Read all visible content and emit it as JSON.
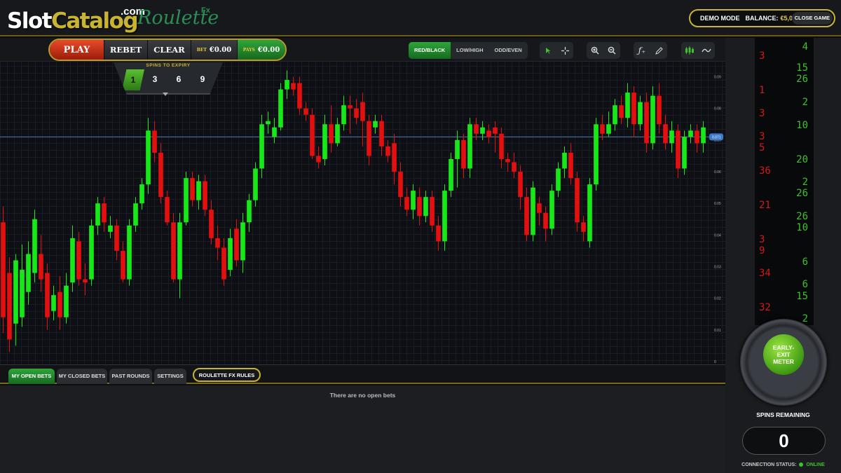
{
  "header": {
    "logo_left": "Slot",
    "logo_right": "Catalog",
    "logo_com": ".com",
    "game_title": "Roulette",
    "game_suffix": "Fx",
    "demo_label": "DEMO MODE",
    "balance_label": "BALANCE:",
    "balance_value": "€5,000.00",
    "close_label": "CLOSE GAME"
  },
  "controls": {
    "play": "PLAY",
    "rebet": "REBET",
    "clear": "CLEAR",
    "bet_label": "BET",
    "bet_value": "€0.00",
    "pays_label": "PAYS",
    "pays_value": "€0.00"
  },
  "spins_to_expiry": {
    "title": "SPINS TO EXPIRY",
    "options": [
      "1",
      "3",
      "6",
      "9"
    ],
    "selected": "1"
  },
  "bet_types": [
    "RED/BLACK",
    "LOW/HIGH",
    "ODD/EVEN"
  ],
  "active_bet_type": "RED/BLACK",
  "tools": {
    "cursor": "cursor-icon",
    "crosshair": "crosshair-icon",
    "zoom_in": "zoom-in-icon",
    "zoom_out": "zoom-out-icon",
    "function": "function-icon",
    "pencil": "pencil-icon",
    "candles": "candlestick-icon",
    "line": "line-chart-icon"
  },
  "chart_data": {
    "type": "candlestick",
    "y_ticks": [
      "0.09",
      "0.08",
      "0.07",
      "0.06",
      "0.05",
      "0.04",
      "0.03",
      "0.02",
      "0.01",
      "0"
    ],
    "ylim": [
      0,
      0.093
    ],
    "current_price": "0.071",
    "colors": {
      "up": "#17e817",
      "down": "#e40f0f"
    },
    "candles": [
      {
        "o": 0.044,
        "c": 0.014,
        "h": 0.049,
        "l": 0.009
      },
      {
        "o": 0.028,
        "c": 0.007,
        "h": 0.033,
        "l": 0.003
      },
      {
        "o": 0.012,
        "c": 0.032,
        "h": 0.034,
        "l": 0.005
      },
      {
        "o": 0.014,
        "c": 0.029,
        "h": 0.037,
        "l": 0.011
      },
      {
        "o": 0.022,
        "c": 0.034,
        "h": 0.038,
        "l": 0.018
      },
      {
        "o": 0.028,
        "c": 0.045,
        "h": 0.048,
        "l": 0.025
      },
      {
        "o": 0.034,
        "c": 0.026,
        "h": 0.04,
        "l": 0.022
      },
      {
        "o": 0.028,
        "c": 0.014,
        "h": 0.031,
        "l": 0.01
      },
      {
        "o": 0.016,
        "c": 0.021,
        "h": 0.024,
        "l": 0.013
      },
      {
        "o": 0.022,
        "c": 0.014,
        "h": 0.027,
        "l": 0.01
      },
      {
        "o": 0.014,
        "c": 0.024,
        "h": 0.028,
        "l": 0.012
      },
      {
        "o": 0.025,
        "c": 0.039,
        "h": 0.043,
        "l": 0.022
      },
      {
        "o": 0.038,
        "c": 0.026,
        "h": 0.041,
        "l": 0.024
      },
      {
        "o": 0.026,
        "c": 0.025,
        "h": 0.031,
        "l": 0.021
      },
      {
        "o": 0.026,
        "c": 0.043,
        "h": 0.045,
        "l": 0.024
      },
      {
        "o": 0.043,
        "c": 0.05,
        "h": 0.052,
        "l": 0.04
      },
      {
        "o": 0.05,
        "c": 0.044,
        "h": 0.052,
        "l": 0.041
      },
      {
        "o": 0.041,
        "c": 0.043,
        "h": 0.046,
        "l": 0.039
      },
      {
        "o": 0.043,
        "c": 0.035,
        "h": 0.045,
        "l": 0.032
      },
      {
        "o": 0.035,
        "c": 0.026,
        "h": 0.038,
        "l": 0.025
      },
      {
        "o": 0.026,
        "c": 0.043,
        "h": 0.045,
        "l": 0.024
      },
      {
        "o": 0.043,
        "c": 0.05,
        "h": 0.052,
        "l": 0.041
      },
      {
        "o": 0.05,
        "c": 0.056,
        "h": 0.058,
        "l": 0.048
      },
      {
        "o": 0.056,
        "c": 0.073,
        "h": 0.077,
        "l": 0.053
      },
      {
        "o": 0.073,
        "c": 0.066,
        "h": 0.076,
        "l": 0.063
      },
      {
        "o": 0.066,
        "c": 0.052,
        "h": 0.069,
        "l": 0.05
      },
      {
        "o": 0.052,
        "c": 0.044,
        "h": 0.054,
        "l": 0.043
      },
      {
        "o": 0.044,
        "c": 0.026,
        "h": 0.047,
        "l": 0.025
      },
      {
        "o": 0.026,
        "c": 0.044,
        "h": 0.047,
        "l": 0.02
      },
      {
        "o": 0.044,
        "c": 0.058,
        "h": 0.06,
        "l": 0.043
      },
      {
        "o": 0.058,
        "c": 0.051,
        "h": 0.06,
        "l": 0.049
      },
      {
        "o": 0.051,
        "c": 0.057,
        "h": 0.059,
        "l": 0.048
      },
      {
        "o": 0.057,
        "c": 0.048,
        "h": 0.059,
        "l": 0.046
      },
      {
        "o": 0.048,
        "c": 0.039,
        "h": 0.051,
        "l": 0.037
      },
      {
        "o": 0.039,
        "c": 0.036,
        "h": 0.043,
        "l": 0.032
      },
      {
        "o": 0.036,
        "c": 0.026,
        "h": 0.039,
        "l": 0.024
      },
      {
        "o": 0.029,
        "c": 0.039,
        "h": 0.042,
        "l": 0.027
      },
      {
        "o": 0.042,
        "c": 0.032,
        "h": 0.045,
        "l": 0.03
      },
      {
        "o": 0.032,
        "c": 0.044,
        "h": 0.047,
        "l": 0.028
      },
      {
        "o": 0.044,
        "c": 0.051,
        "h": 0.053,
        "l": 0.041
      },
      {
        "o": 0.051,
        "c": 0.061,
        "h": 0.063,
        "l": 0.049
      },
      {
        "o": 0.061,
        "c": 0.075,
        "h": 0.078,
        "l": 0.058
      },
      {
        "o": 0.075,
        "c": 0.076,
        "h": 0.079,
        "l": 0.072
      },
      {
        "o": 0.071,
        "c": 0.074,
        "h": 0.077,
        "l": 0.069
      },
      {
        "o": 0.074,
        "c": 0.086,
        "h": 0.088,
        "l": 0.073
      },
      {
        "o": 0.086,
        "c": 0.089,
        "h": 0.092,
        "l": 0.083
      },
      {
        "o": 0.088,
        "c": 0.086,
        "h": 0.09,
        "l": 0.084
      },
      {
        "o": 0.088,
        "c": 0.08,
        "h": 0.09,
        "l": 0.078
      },
      {
        "o": 0.08,
        "c": 0.078,
        "h": 0.082,
        "l": 0.076
      },
      {
        "o": 0.078,
        "c": 0.065,
        "h": 0.08,
        "l": 0.064
      },
      {
        "o": 0.065,
        "c": 0.063,
        "h": 0.068,
        "l": 0.061
      },
      {
        "o": 0.064,
        "c": 0.075,
        "h": 0.078,
        "l": 0.062
      },
      {
        "o": 0.075,
        "c": 0.069,
        "h": 0.081,
        "l": 0.066
      },
      {
        "o": 0.069,
        "c": 0.075,
        "h": 0.077,
        "l": 0.068
      },
      {
        "o": 0.075,
        "c": 0.081,
        "h": 0.084,
        "l": 0.073
      },
      {
        "o": 0.081,
        "c": 0.08,
        "h": 0.084,
        "l": 0.072
      },
      {
        "o": 0.08,
        "c": 0.077,
        "h": 0.083,
        "l": 0.075
      },
      {
        "o": 0.082,
        "c": 0.076,
        "h": 0.085,
        "l": 0.068
      },
      {
        "o": 0.076,
        "c": 0.065,
        "h": 0.078,
        "l": 0.062
      },
      {
        "o": 0.074,
        "c": 0.076,
        "h": 0.078,
        "l": 0.072
      },
      {
        "o": 0.076,
        "c": 0.068,
        "h": 0.078,
        "l": 0.065
      },
      {
        "o": 0.068,
        "c": 0.065,
        "h": 0.07,
        "l": 0.063
      },
      {
        "o": 0.069,
        "c": 0.06,
        "h": 0.072,
        "l": 0.056
      },
      {
        "o": 0.06,
        "c": 0.052,
        "h": 0.063,
        "l": 0.049
      },
      {
        "o": 0.052,
        "c": 0.048,
        "h": 0.055,
        "l": 0.046
      },
      {
        "o": 0.048,
        "c": 0.054,
        "h": 0.056,
        "l": 0.045
      },
      {
        "o": 0.052,
        "c": 0.046,
        "h": 0.055,
        "l": 0.043
      },
      {
        "o": 0.046,
        "c": 0.052,
        "h": 0.054,
        "l": 0.044
      },
      {
        "o": 0.052,
        "c": 0.043,
        "h": 0.054,
        "l": 0.041
      },
      {
        "o": 0.043,
        "c": 0.038,
        "h": 0.046,
        "l": 0.035
      },
      {
        "o": 0.038,
        "c": 0.054,
        "h": 0.056,
        "l": 0.035
      },
      {
        "o": 0.054,
        "c": 0.064,
        "h": 0.066,
        "l": 0.052
      },
      {
        "o": 0.064,
        "c": 0.07,
        "h": 0.073,
        "l": 0.055
      },
      {
        "o": 0.07,
        "c": 0.061,
        "h": 0.072,
        "l": 0.058
      },
      {
        "o": 0.061,
        "c": 0.075,
        "h": 0.077,
        "l": 0.058
      },
      {
        "o": 0.075,
        "c": 0.072,
        "h": 0.077,
        "l": 0.07
      },
      {
        "o": 0.072,
        "c": 0.074,
        "h": 0.076,
        "l": 0.07
      },
      {
        "o": 0.073,
        "c": 0.071,
        "h": 0.075,
        "l": 0.069
      },
      {
        "o": 0.074,
        "c": 0.072,
        "h": 0.076,
        "l": 0.066
      },
      {
        "o": 0.072,
        "c": 0.064,
        "h": 0.074,
        "l": 0.061
      },
      {
        "o": 0.064,
        "c": 0.063,
        "h": 0.066,
        "l": 0.06
      },
      {
        "o": 0.063,
        "c": 0.06,
        "h": 0.066,
        "l": 0.058
      },
      {
        "o": 0.06,
        "c": 0.052,
        "h": 0.062,
        "l": 0.048
      },
      {
        "o": 0.052,
        "c": 0.04,
        "h": 0.055,
        "l": 0.038
      },
      {
        "o": 0.04,
        "c": 0.055,
        "h": 0.057,
        "l": 0.038
      },
      {
        "o": 0.05,
        "c": 0.047,
        "h": 0.052,
        "l": 0.043
      },
      {
        "o": 0.047,
        "c": 0.042,
        "h": 0.049,
        "l": 0.038
      },
      {
        "o": 0.042,
        "c": 0.054,
        "h": 0.056,
        "l": 0.04
      },
      {
        "o": 0.054,
        "c": 0.061,
        "h": 0.063,
        "l": 0.052
      },
      {
        "o": 0.061,
        "c": 0.066,
        "h": 0.068,
        "l": 0.058
      },
      {
        "o": 0.066,
        "c": 0.058,
        "h": 0.069,
        "l": 0.056
      },
      {
        "o": 0.058,
        "c": 0.044,
        "h": 0.06,
        "l": 0.041
      },
      {
        "o": 0.044,
        "c": 0.041,
        "h": 0.046,
        "l": 0.038
      },
      {
        "o": 0.038,
        "c": 0.056,
        "h": 0.058,
        "l": 0.036
      },
      {
        "o": 0.056,
        "c": 0.075,
        "h": 0.077,
        "l": 0.054
      },
      {
        "o": 0.075,
        "c": 0.072,
        "h": 0.078,
        "l": 0.07
      },
      {
        "o": 0.072,
        "c": 0.075,
        "h": 0.079,
        "l": 0.071
      },
      {
        "o": 0.075,
        "c": 0.081,
        "h": 0.083,
        "l": 0.073
      },
      {
        "o": 0.081,
        "c": 0.077,
        "h": 0.084,
        "l": 0.075
      },
      {
        "o": 0.077,
        "c": 0.085,
        "h": 0.088,
        "l": 0.074
      },
      {
        "o": 0.085,
        "c": 0.075,
        "h": 0.087,
        "l": 0.071
      },
      {
        "o": 0.075,
        "c": 0.082,
        "h": 0.084,
        "l": 0.073
      },
      {
        "o": 0.082,
        "c": 0.069,
        "h": 0.085,
        "l": 0.066
      },
      {
        "o": 0.069,
        "c": 0.084,
        "h": 0.087,
        "l": 0.067
      },
      {
        "o": 0.084,
        "c": 0.075,
        "h": 0.088,
        "l": 0.072
      },
      {
        "o": 0.075,
        "c": 0.069,
        "h": 0.078,
        "l": 0.067
      },
      {
        "o": 0.069,
        "c": 0.073,
        "h": 0.076,
        "l": 0.066
      },
      {
        "o": 0.073,
        "c": 0.061,
        "h": 0.075,
        "l": 0.058
      },
      {
        "o": 0.061,
        "c": 0.071,
        "h": 0.073,
        "l": 0.059
      },
      {
        "o": 0.071,
        "c": 0.073,
        "h": 0.075,
        "l": 0.069
      },
      {
        "o": 0.073,
        "c": 0.069,
        "h": 0.075,
        "l": 0.066
      },
      {
        "o": 0.069,
        "c": 0.074,
        "h": 0.076,
        "l": 0.066
      }
    ]
  },
  "tabs": [
    "MY OPEN BETS",
    "MY CLOSED BETS",
    "PAST ROUNDS",
    "SETTINGS"
  ],
  "rules_label": "ROULETTE FX RULES",
  "no_bets_message": "There are no open bets",
  "ticker": [
    {
      "n": "4",
      "c": "green",
      "side": "right",
      "y": 5
    },
    {
      "n": "3",
      "c": "red",
      "side": "left",
      "y": 18
    },
    {
      "n": "15",
      "c": "green",
      "side": "right",
      "y": 35
    },
    {
      "n": "26",
      "c": "green",
      "side": "right",
      "y": 51
    },
    {
      "n": "1",
      "c": "red",
      "side": "left",
      "y": 67
    },
    {
      "n": "2",
      "c": "green",
      "side": "right",
      "y": 84
    },
    {
      "n": "3",
      "c": "red",
      "side": "left",
      "y": 100
    },
    {
      "n": "10",
      "c": "green",
      "side": "right",
      "y": 117
    },
    {
      "n": "3",
      "c": "red",
      "side": "left",
      "y": 133
    },
    {
      "n": "5",
      "c": "red",
      "side": "left",
      "y": 149
    },
    {
      "n": "20",
      "c": "green",
      "side": "right",
      "y": 166
    },
    {
      "n": "36",
      "c": "red",
      "side": "left",
      "y": 182
    },
    {
      "n": "2",
      "c": "green",
      "side": "right",
      "y": 198
    },
    {
      "n": "26",
      "c": "green",
      "side": "right",
      "y": 214
    },
    {
      "n": "21",
      "c": "red",
      "side": "left",
      "y": 231
    },
    {
      "n": "26",
      "c": "green",
      "side": "right",
      "y": 247
    },
    {
      "n": "10",
      "c": "green",
      "side": "right",
      "y": 263
    },
    {
      "n": "3",
      "c": "red",
      "side": "left",
      "y": 280
    },
    {
      "n": "9",
      "c": "red",
      "side": "left",
      "y": 296
    },
    {
      "n": "6",
      "c": "green",
      "side": "right",
      "y": 312
    },
    {
      "n": "34",
      "c": "red",
      "side": "left",
      "y": 328
    },
    {
      "n": "6",
      "c": "green",
      "side": "right",
      "y": 344
    },
    {
      "n": "15",
      "c": "green",
      "side": "right",
      "y": 361
    },
    {
      "n": "32",
      "c": "red",
      "side": "left",
      "y": 377
    },
    {
      "n": "2",
      "c": "green",
      "side": "right",
      "y": 393
    }
  ],
  "meter_label": "EARLY-EXIT METER",
  "spins_remaining_label": "SPINS REMAINING",
  "spins_remaining_value": "0",
  "connection_label": "CONNECTION STATUS:",
  "connection_value": "ONLINE"
}
